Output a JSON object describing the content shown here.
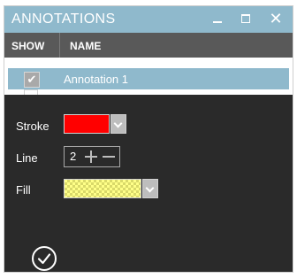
{
  "window": {
    "title": "ANNOTATIONS",
    "minimize_icon": "minimize-icon",
    "maximize_icon": "maximize-icon",
    "close_icon": "close-icon",
    "close_glyph": "✕",
    "accent_color": "#8fb9cc"
  },
  "grid": {
    "columns": [
      "SHOW",
      "NAME"
    ],
    "rows": [
      {
        "checked": true,
        "check_glyph": "✔",
        "name": "Annotation 1",
        "selected": true
      }
    ]
  },
  "properties": {
    "stroke": {
      "label": "Stroke",
      "color": "#ff0000"
    },
    "line": {
      "label": "Line",
      "value": "2"
    },
    "fill": {
      "label": "Fill",
      "color": "#ffff88",
      "pattern": "checker"
    }
  },
  "confirm": {
    "icon": "check-circle-icon"
  }
}
